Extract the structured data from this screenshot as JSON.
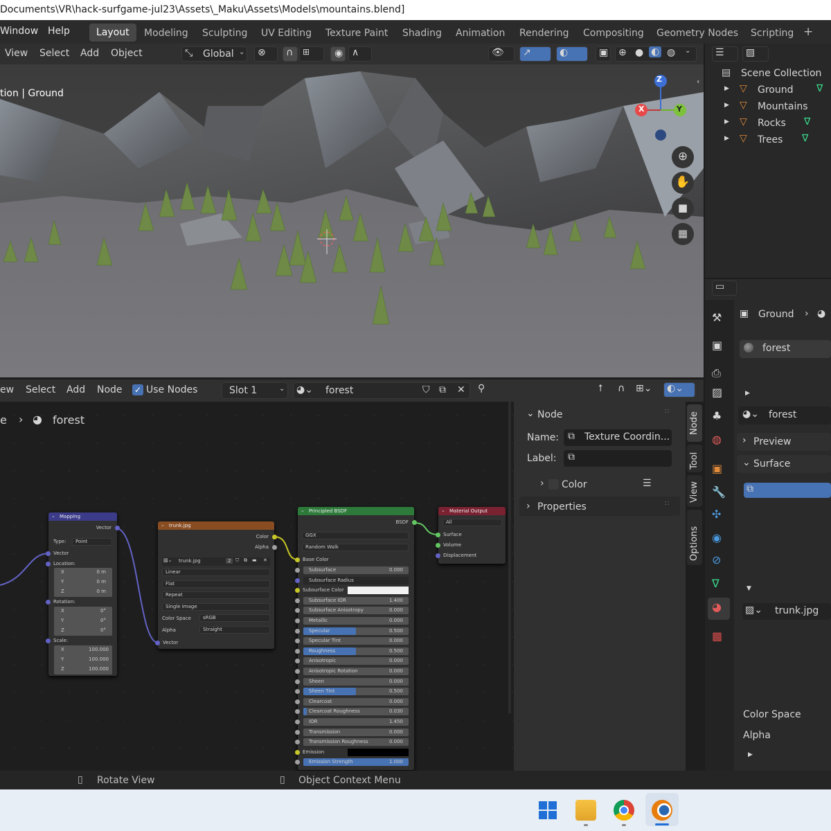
{
  "title_bar": {
    "path": "Documents\\VR\\hack-surfgame-jul23\\Assets\\_Maku\\Assets\\Models\\mountains.blend]"
  },
  "top_menu": {
    "items": [
      "Window",
      "Help"
    ]
  },
  "workspaces": {
    "tabs": [
      "Layout",
      "Modeling",
      "Sculpting",
      "UV Editing",
      "Texture Paint",
      "Shading",
      "Animation",
      "Rendering",
      "Compositing",
      "Geometry Nodes",
      "Scripting"
    ],
    "active": "Layout",
    "add": "+"
  },
  "viewport": {
    "menus": [
      "View",
      "Select",
      "Add",
      "Object"
    ],
    "transform_orientation": "Global",
    "object_info": "tion | Ground",
    "gizmo": {
      "z": "Z",
      "y": "Y",
      "x": "X"
    }
  },
  "outliner": {
    "root": "Scene Collection",
    "items": [
      "Ground",
      "Mountains",
      "Rocks",
      "Trees"
    ]
  },
  "properties": {
    "object_name": "Ground",
    "material_slot": "forest",
    "material_name": "forest",
    "sections": {
      "preview": "Preview",
      "surface": "Surface"
    },
    "image_name": "trunk.jpg",
    "color_space": "Color Space",
    "alpha": "Alpha"
  },
  "node_editor": {
    "menus": [
      "ew",
      "Select",
      "Add",
      "Node"
    ],
    "use_nodes_label": "Use Nodes",
    "slot": "Slot 1",
    "material": "forest",
    "breadcrumb_prefix": "e",
    "breadcrumb_material": "forest"
  },
  "n_panel": {
    "section_node": "Node",
    "name_label": "Name:",
    "name_value": "Texture Coordin...",
    "label_label": "Label:",
    "color_label": "Color",
    "properties_label": "Properties",
    "tabs": [
      "Node",
      "Tool",
      "View",
      "Options"
    ]
  },
  "nodes": {
    "mapping": {
      "title": "Mapping",
      "output": "Vector",
      "type_label": "Type:",
      "type_value": "Point",
      "vector_in": "Vector",
      "location": "Location:",
      "rotation": "Rotation:",
      "scale": "Scale:",
      "loc": [
        [
          "X",
          "0 m"
        ],
        [
          "Y",
          "0 m"
        ],
        [
          "Z",
          "0 m"
        ]
      ],
      "rot": [
        [
          "X",
          "0°"
        ],
        [
          "Y",
          "0°"
        ],
        [
          "Z",
          "0°"
        ]
      ],
      "scl": [
        [
          "X",
          "100.000"
        ],
        [
          "Y",
          "100.000"
        ],
        [
          "Z",
          "100.000"
        ]
      ]
    },
    "image": {
      "title": "trunk.jpg",
      "out_color": "Color",
      "out_alpha": "Alpha",
      "image_name": "trunk.jpg",
      "users": "2",
      "interp": "Linear",
      "proj": "Flat",
      "ext": "Repeat",
      "source": "Single Image",
      "cs_label": "Color Space",
      "cs_value": "sRGB",
      "alpha_label": "Alpha",
      "alpha_value": "Straight",
      "vector": "Vector"
    },
    "bsdf": {
      "title": "Principled BSDF",
      "output": "BSDF",
      "dist": "GGX",
      "sss_method": "Random Walk",
      "base_color": "Base Color",
      "rows": [
        [
          "Subsurface",
          "0.000"
        ],
        [
          "Subsurface Radius",
          ""
        ],
        [
          "Subsurface Color",
          ""
        ],
        [
          "Subsurface IOR",
          "1.400"
        ],
        [
          "Subsurface Anisotropy",
          "0.000"
        ],
        [
          "Metallic",
          "0.000"
        ],
        [
          "Specular",
          "0.500"
        ],
        [
          "Specular Tint",
          "0.000"
        ],
        [
          "Roughness",
          "0.500"
        ],
        [
          "Anisotropic",
          "0.000"
        ],
        [
          "Anisotropic Rotation",
          "0.000"
        ],
        [
          "Sheen",
          "0.000"
        ],
        [
          "Sheen Tint",
          "0.500"
        ],
        [
          "Clearcoat",
          "0.000"
        ],
        [
          "Clearcoat Roughness",
          "0.030"
        ],
        [
          "IOR",
          "1.450"
        ],
        [
          "Transmission",
          "0.000"
        ],
        [
          "Transmission Roughness",
          "0.000"
        ],
        [
          "Emission",
          ""
        ],
        [
          "Emission Strength",
          "1.000"
        ]
      ]
    },
    "output": {
      "title": "Material Output",
      "target": "All",
      "surface": "Surface",
      "volume": "Volume",
      "displacement": "Displacement"
    }
  },
  "status_bar": {
    "left": "Rotate View",
    "right": "Object Context Menu"
  }
}
